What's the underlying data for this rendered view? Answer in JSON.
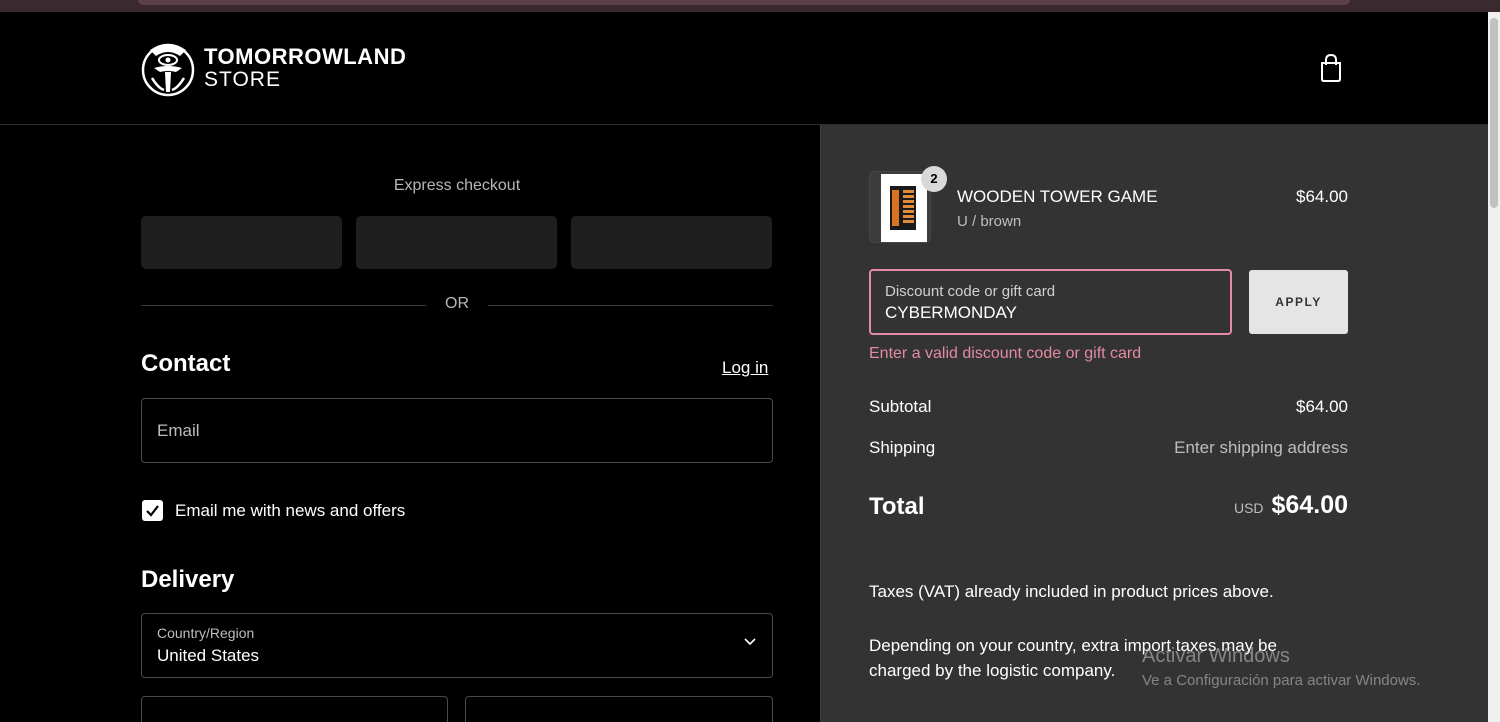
{
  "header": {
    "brand_line1": "TOMORROWLAND",
    "brand_line2": "STORE",
    "logo_icon": "tomorrowland-logo",
    "cart_icon": "shopping-bag-icon"
  },
  "express": {
    "title": "Express checkout",
    "or_label": "OR"
  },
  "contact": {
    "heading": "Contact",
    "login_label": "Log in",
    "email_placeholder": "Email",
    "newsletter_label": "Email me with news and offers",
    "newsletter_checked": true
  },
  "delivery": {
    "heading": "Delivery",
    "country_label": "Country/Region",
    "country_value": "United States"
  },
  "summary": {
    "product": {
      "name": "WOODEN TOWER GAME",
      "variant": "U / brown",
      "price": "$64.00",
      "quantity": "2"
    },
    "discount": {
      "label": "Discount code or gift card",
      "value": "CYBERMONDAY",
      "apply_label": "APPLY",
      "error": "Enter a valid discount code or gift card"
    },
    "subtotal_label": "Subtotal",
    "subtotal_value": "$64.00",
    "shipping_label": "Shipping",
    "shipping_value": "Enter shipping address",
    "total_label": "Total",
    "total_currency": "USD",
    "total_value": "$64.00",
    "tax_note": "Taxes (VAT) already included in product prices above.",
    "import_note_line1": "Depending on your country, extra import taxes may be",
    "import_note_line2": "charged by the logistic company."
  },
  "watermark": {
    "line1": "Activar Windows",
    "line2": "Ve a Configuración para activar Windows."
  },
  "colors": {
    "accent_error": "#e38ba2",
    "panel": "#333333",
    "background": "#000000"
  }
}
